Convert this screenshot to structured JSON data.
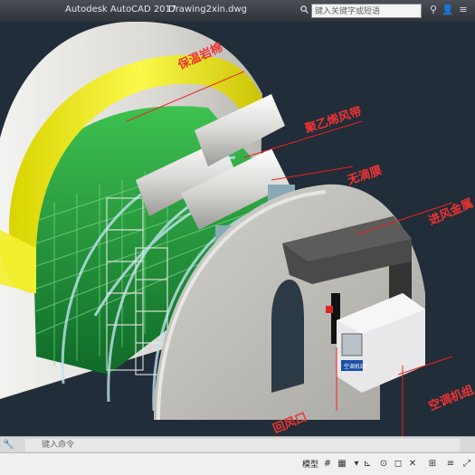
{
  "titlebar": {
    "app_name": "Autodesk AutoCAD 2017",
    "file_name": "Drawing2xin.dwg",
    "search_placeholder": "键入关键字或短语"
  },
  "callouts": {
    "c1": "保温岩棉",
    "c2": "聚乙烯风带",
    "c3": "无滴膜",
    "c4": "进风金属",
    "c5": "空调机组",
    "c6": "回风口"
  },
  "unit_label": "空调机组",
  "command": {
    "placeholder": "键入命令"
  },
  "status": {
    "model_tab": "模型"
  },
  "colors": {
    "insulation": "#f2ef2b",
    "shell": "#d6d4cf",
    "plants": "#1f9a3a",
    "callout": "#ee2222"
  }
}
